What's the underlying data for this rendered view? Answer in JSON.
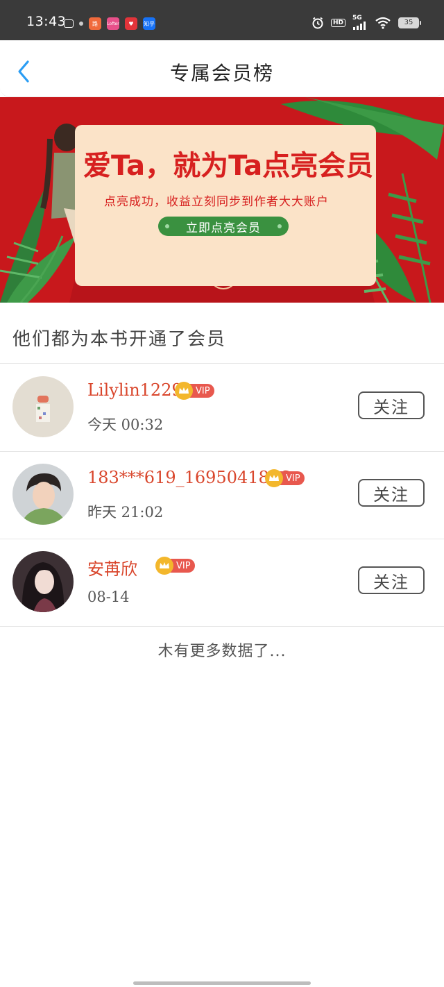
{
  "status_bar": {
    "time": "13:43",
    "apps": [
      {
        "icon": "cloud-app-icon",
        "label": "",
        "color": "#3a3a3a"
      },
      {
        "icon": "orange-app-icon",
        "label": "路",
        "color": "#f06a3c"
      },
      {
        "icon": "pink-app-icon",
        "label": "Lofter",
        "color": "#e8508a"
      },
      {
        "icon": "heart-app-icon",
        "label": "",
        "color": "#e2343a"
      },
      {
        "icon": "zhihu-app-icon",
        "label": "知乎",
        "color": "#1772f6"
      }
    ],
    "network": "5G",
    "hd_label": "HD",
    "battery": "35"
  },
  "nav": {
    "title": "专属会员榜",
    "back_icon": "chevron-left-icon"
  },
  "banner": {
    "heading": "爱Ta，就为Ta点亮会员",
    "subtitle": "点亮成功，收益立刻同步到作者大大账户",
    "button_label": "立即点亮会员",
    "colors": {
      "background": "#c8181c",
      "card": "#fbe3c8",
      "button": "#3a9140",
      "text": "#d7201f"
    }
  },
  "section": {
    "title": "他们都为本书开通了会员"
  },
  "members": [
    {
      "name": "Lilylin1229",
      "vip_label": "VIP",
      "time": "今天 00:32",
      "follow_label": "关注",
      "avatar": "avatar-icon"
    },
    {
      "name": "183***619_1695041856",
      "vip_label": "VIP",
      "time": "昨天 21:02",
      "follow_label": "关注",
      "avatar": "avatar-icon"
    },
    {
      "name": "安苒欣",
      "vip_label": "VIP",
      "time": "08-14",
      "follow_label": "关注",
      "avatar": "avatar-icon"
    }
  ],
  "footer": {
    "no_more": "木有更多数据了..."
  },
  "colors": {
    "accent_blue": "#2a9df4",
    "name_red": "#d9462c",
    "vip_red": "#e8584e",
    "crown_gold": "#f3b72c"
  }
}
